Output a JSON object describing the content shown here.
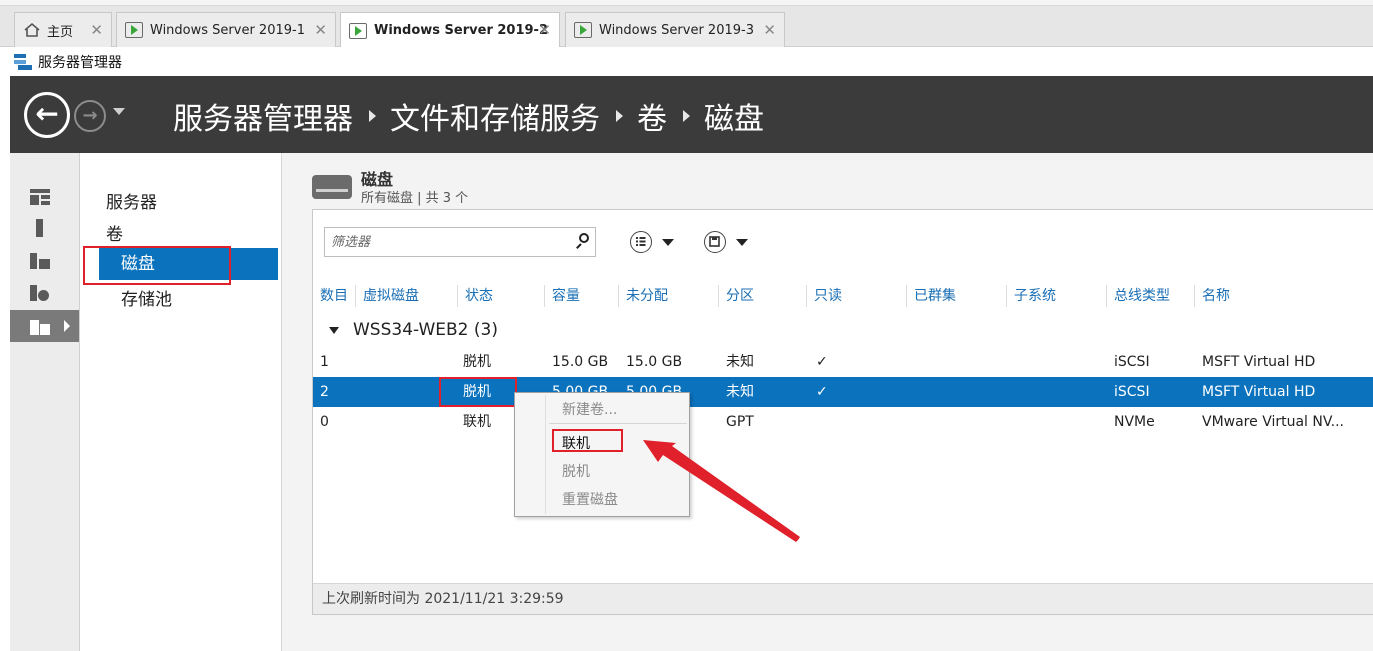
{
  "tabs": [
    {
      "label": "主页",
      "active": false
    },
    {
      "label": "Windows Server 2019-1",
      "active": false
    },
    {
      "label": "Windows Server 2019-2",
      "active": true
    },
    {
      "label": "Windows Server 2019-3",
      "active": false
    }
  ],
  "window": {
    "title": "服务器管理器"
  },
  "breadcrumb": [
    "服务器管理器",
    "文件和存储服务",
    "卷",
    "磁盘"
  ],
  "nav": {
    "items": [
      "服务器",
      "卷",
      "磁盘",
      "存储池"
    ],
    "selected": "磁盘"
  },
  "section": {
    "title": "磁盘",
    "subtitle": "所有磁盘 | 共 3 个"
  },
  "filter": {
    "placeholder": "筛选器"
  },
  "columns": [
    "数目",
    "虚拟磁盘",
    "状态",
    "容量",
    "未分配",
    "分区",
    "只读",
    "已群集",
    "子系统",
    "总线类型",
    "名称"
  ],
  "group": {
    "label": "WSS34-WEB2 (3)"
  },
  "rows": [
    {
      "num": "1",
      "virtual": "",
      "status": "脱机",
      "capacity": "15.0 GB",
      "unallocated": "15.0 GB",
      "partition": "未知",
      "readonly": "✓",
      "clustered": "",
      "subsystem": "",
      "bus": "iSCSI",
      "name": "MSFT Virtual HD",
      "selected": false
    },
    {
      "num": "2",
      "virtual": "",
      "status": "脱机",
      "capacity": "5.00 GB",
      "unallocated": "5.00 GB",
      "partition": "未知",
      "readonly": "✓",
      "clustered": "",
      "subsystem": "",
      "bus": "iSCSI",
      "name": "MSFT Virtual HD",
      "selected": true
    },
    {
      "num": "0",
      "virtual": "",
      "status": "联机",
      "capacity": "",
      "unallocated": "",
      "partition": "GPT",
      "readonly": "",
      "clustered": "",
      "subsystem": "",
      "bus": "NVMe",
      "name": "VMware Virtual NV...",
      "selected": false
    }
  ],
  "context_menu": {
    "items": [
      {
        "label": "新建卷...",
        "enabled": false
      },
      {
        "label": "联机",
        "enabled": true
      },
      {
        "label": "脱机",
        "enabled": false
      },
      {
        "label": "重置磁盘",
        "enabled": false
      }
    ]
  },
  "footer": {
    "status": "上次刷新时间为 2021/11/21 3:29:59"
  },
  "colors": {
    "accent": "#0b72bd",
    "header_bg": "#3b3b3b",
    "annotation": "#e0202a",
    "column_header_text": "#1a6fb5"
  },
  "icons": [
    "home-icon",
    "vm-icon",
    "close-icon",
    "server-manager-icon",
    "back-arrow-icon",
    "forward-arrow-icon",
    "dashboard-icon",
    "local-server-icon",
    "all-servers-icon",
    "file-services-icon",
    "storage-icon",
    "disk-icon",
    "search-icon",
    "list-view-icon",
    "save-icon",
    "expand-triangle-icon"
  ]
}
